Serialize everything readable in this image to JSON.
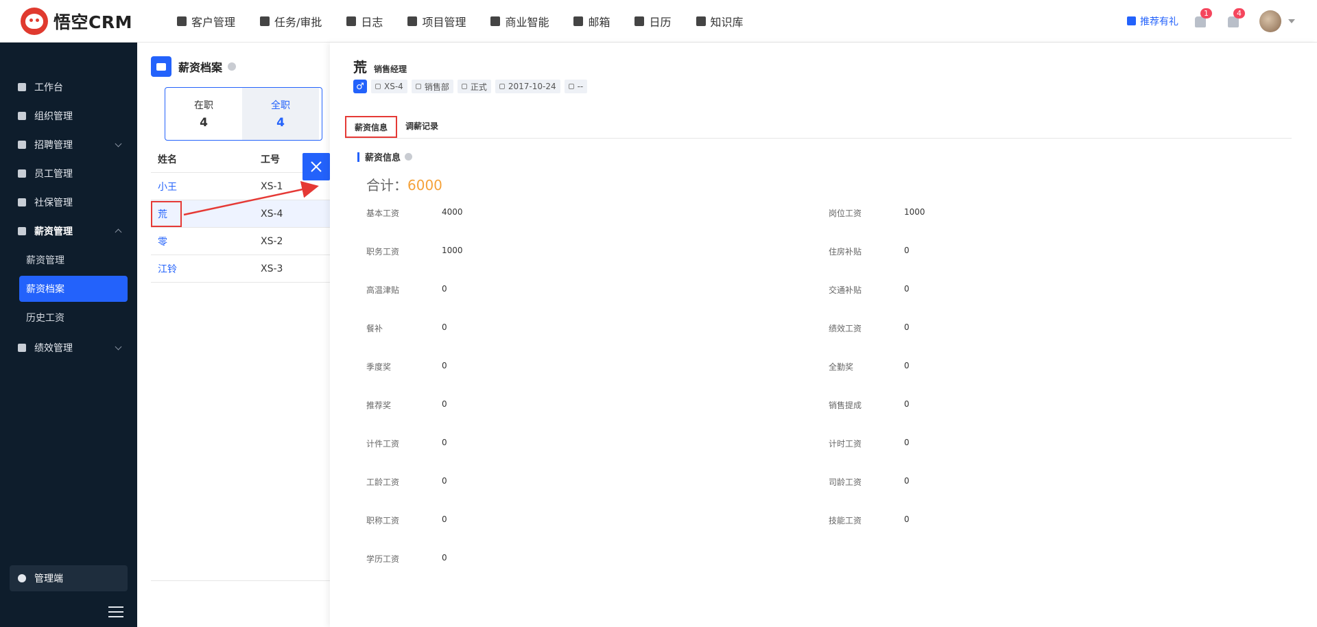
{
  "app": {
    "logo_text": "悟空CRM"
  },
  "nav": [
    {
      "label": "客户管理"
    },
    {
      "label": "任务/审批"
    },
    {
      "label": "日志"
    },
    {
      "label": "项目管理"
    },
    {
      "label": "商业智能"
    },
    {
      "label": "邮箱"
    },
    {
      "label": "日历"
    },
    {
      "label": "知识库"
    }
  ],
  "topright": {
    "gift_label": "推荐有礼",
    "speaker_badge": "1",
    "bell_badge": "4"
  },
  "sidebar": {
    "items": [
      {
        "label": "工作台"
      },
      {
        "label": "组织管理"
      },
      {
        "label": "招聘管理"
      },
      {
        "label": "员工管理"
      },
      {
        "label": "社保管理"
      },
      {
        "label": "薪资管理"
      }
    ],
    "sub_items": [
      {
        "label": "薪资管理"
      },
      {
        "label": "薪资档案"
      },
      {
        "label": "历史工资"
      }
    ],
    "after_items": [
      {
        "label": "绩效管理"
      }
    ],
    "admin_label": "管理端"
  },
  "page": {
    "title": "薪资档案",
    "stats": [
      {
        "label": "在职",
        "value": "4"
      },
      {
        "label": "全职",
        "value": "4"
      }
    ],
    "table": {
      "headers": [
        "姓名",
        "工号"
      ],
      "rows": [
        {
          "name": "小王",
          "id": "XS-1"
        },
        {
          "name": "荒",
          "id": "XS-4"
        },
        {
          "name": "零",
          "id": "XS-2"
        },
        {
          "name": "江铃",
          "id": "XS-3"
        }
      ]
    }
  },
  "detail": {
    "name": "荒",
    "position": "销售经理",
    "gender_symbol": "♂",
    "tags": [
      "XS-4",
      "销售部",
      "正式",
      "2017-10-24",
      "--"
    ],
    "tabs": [
      "薪资信息",
      "调薪记录"
    ],
    "section_title": "薪资信息",
    "total_label": "合计：",
    "total_value": "6000",
    "fields": [
      {
        "k": "基本工资",
        "v": "4000"
      },
      {
        "k": "岗位工资",
        "v": "1000"
      },
      {
        "k": "职务工资",
        "v": "1000"
      },
      {
        "k": "住房补贴",
        "v": "0"
      },
      {
        "k": "高温津贴",
        "v": "0"
      },
      {
        "k": "交通补贴",
        "v": "0"
      },
      {
        "k": "餐补",
        "v": "0"
      },
      {
        "k": "绩效工资",
        "v": "0"
      },
      {
        "k": "季度奖",
        "v": "0"
      },
      {
        "k": "全勤奖",
        "v": "0"
      },
      {
        "k": "推荐奖",
        "v": "0"
      },
      {
        "k": "销售提成",
        "v": "0"
      },
      {
        "k": "计件工资",
        "v": "0"
      },
      {
        "k": "计时工资",
        "v": "0"
      },
      {
        "k": "工龄工资",
        "v": "0"
      },
      {
        "k": "司龄工资",
        "v": "0"
      },
      {
        "k": "职称工资",
        "v": "0"
      },
      {
        "k": "技能工资",
        "v": "0"
      },
      {
        "k": "学历工资",
        "v": "0"
      }
    ]
  },
  "colors": {
    "accent": "#2362fb",
    "sidebar_bg": "#0e1d2c",
    "highlight": "#e53935",
    "total": "#f5a23a"
  }
}
